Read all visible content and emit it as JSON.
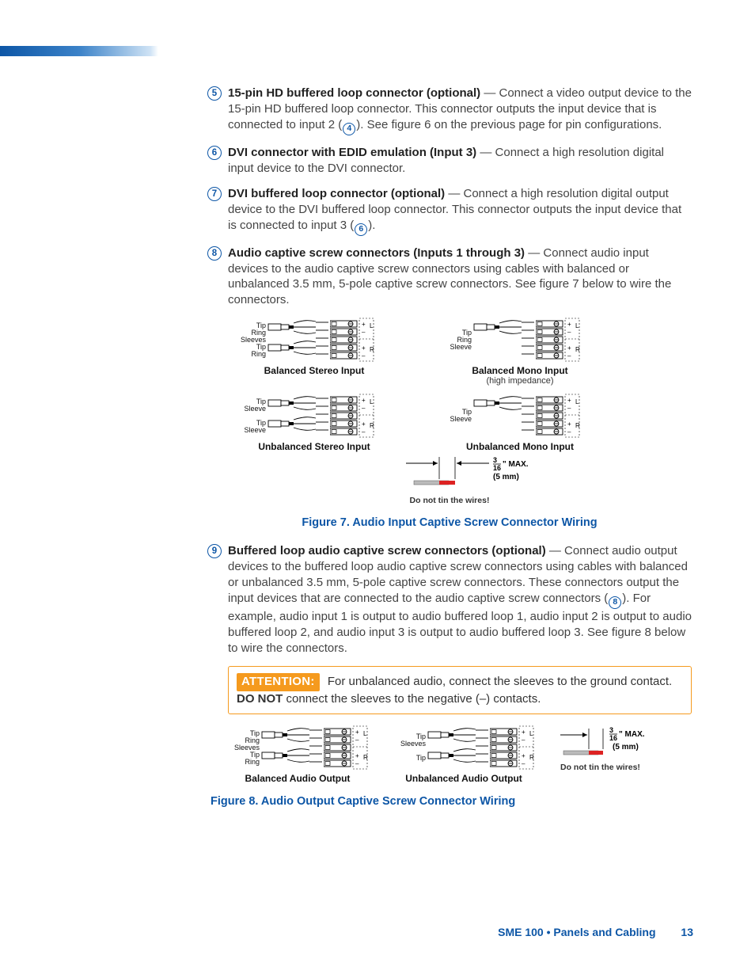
{
  "items": {
    "i5": {
      "num": "5",
      "lead": "15-pin HD buffered loop connector (optional)",
      "text_a": " — Connect a video output device to the 15-pin HD buffered loop connector. This connector outputs the input device that is connected to input 2 (",
      "ref": "4",
      "text_b": "). See figure 6 on the previous page for pin configurations."
    },
    "i6": {
      "num": "6",
      "lead": "DVI connector with EDID emulation (Input 3)",
      "text": " — Connect a high resolution digital input device to the DVI connector."
    },
    "i7": {
      "num": "7",
      "lead": "DVI buffered loop connector (optional)",
      "text_a": " — Connect a high resolution digital output device to the DVI buffered loop connector. This connector outputs the input device that is connected to input 3 (",
      "ref": "6",
      "text_b": ")."
    },
    "i8": {
      "num": "8",
      "lead": "Audio captive screw connectors (Inputs 1 through 3)",
      "text": " — Connect audio input devices to the audio captive screw connectors using cables with balanced or unbalanced 3.5 mm, 5-pole captive screw connectors. See figure 7 below to wire the connectors."
    },
    "i9": {
      "num": "9",
      "lead": "Buffered loop audio captive screw connectors (optional)",
      "text_a": " — Connect audio output devices to the buffered loop audio captive screw connectors using cables with balanced or unbalanced 3.5 mm, 5-pole captive screw connectors. These connectors output the input devices that are connected to the audio captive screw connectors (",
      "ref": "8",
      "text_b": "). For example, audio input 1 is output to audio buffered loop 1, audio input 2 is output to audio buffered loop 2, and audio input 3 is output to audio buffered loop 3. See figure 8 below to wire the connectors."
    }
  },
  "figures": {
    "fig7": "Figure 7.    Audio Input Captive Screw Connector Wiring",
    "fig8": "Figure 8.    Audio Output Captive Screw Connector Wiring"
  },
  "attention": {
    "label": "ATTENTION:",
    "line1": "For unbalanced audio, connect the sleeves to the ground contact.",
    "line2_a": "DO NOT",
    "line2_b": " connect the sleeves to the negative (–) contacts."
  },
  "diagrams": {
    "bal_stereo_in": {
      "caption": "Balanced Stereo Input",
      "labels": [
        "Tip",
        "Ring",
        "Sleeves",
        "Tip",
        "Ring"
      ],
      "polarity": [
        "+",
        "–",
        "",
        "+",
        "–"
      ],
      "lr": [
        "L",
        "",
        "",
        "R",
        ""
      ]
    },
    "bal_mono_in": {
      "caption": "Balanced Mono Input",
      "caption_sub": "(high impedance)",
      "labels": [
        "Tip",
        "Ring",
        "Sleeve"
      ],
      "polarity": [
        "+",
        "–",
        "",
        "+",
        "–"
      ],
      "lr": [
        "L",
        "",
        "",
        "R",
        ""
      ]
    },
    "unbal_stereo_in": {
      "caption": "Unbalanced Stereo Input",
      "labels": [
        "Tip",
        "Sleeve",
        "",
        "Tip",
        "Sleeve"
      ],
      "polarity": [
        "+",
        "–",
        "",
        "+",
        "–"
      ],
      "lr": [
        "L",
        "",
        "",
        "R",
        ""
      ]
    },
    "unbal_mono_in": {
      "caption": "Unbalanced Mono Input",
      "labels": [
        "Tip",
        "Sleeve"
      ],
      "polarity": [
        "+",
        "–",
        "",
        "+",
        "–"
      ],
      "lr": [
        "L",
        "",
        "",
        "R",
        ""
      ]
    },
    "bal_audio_out": {
      "caption": "Balanced Audio Output",
      "labels": [
        "Tip",
        "Ring",
        "Sleeves",
        "Tip",
        "Ring"
      ],
      "polarity": [
        "+",
        "–",
        "",
        "+",
        "–"
      ],
      "lr": [
        "L",
        "",
        "",
        "R",
        ""
      ]
    },
    "unbal_audio_out": {
      "caption": "Unbalanced Audio Output",
      "labels": [
        "Tip",
        "Sleeves",
        "",
        "Tip"
      ],
      "polarity": [
        "+",
        "–",
        "",
        "+",
        "–"
      ],
      "lr": [
        "L",
        "",
        "",
        "R",
        ""
      ]
    },
    "strip": {
      "max_frac_top": "3",
      "max_frac_bot": "16",
      "max_unit": "\" MAX.",
      "max_mm": "(5 mm)",
      "notin": "Do not tin the wires!"
    }
  },
  "footer": {
    "section": "SME 100 • Panels and Cabling",
    "page": "13"
  }
}
